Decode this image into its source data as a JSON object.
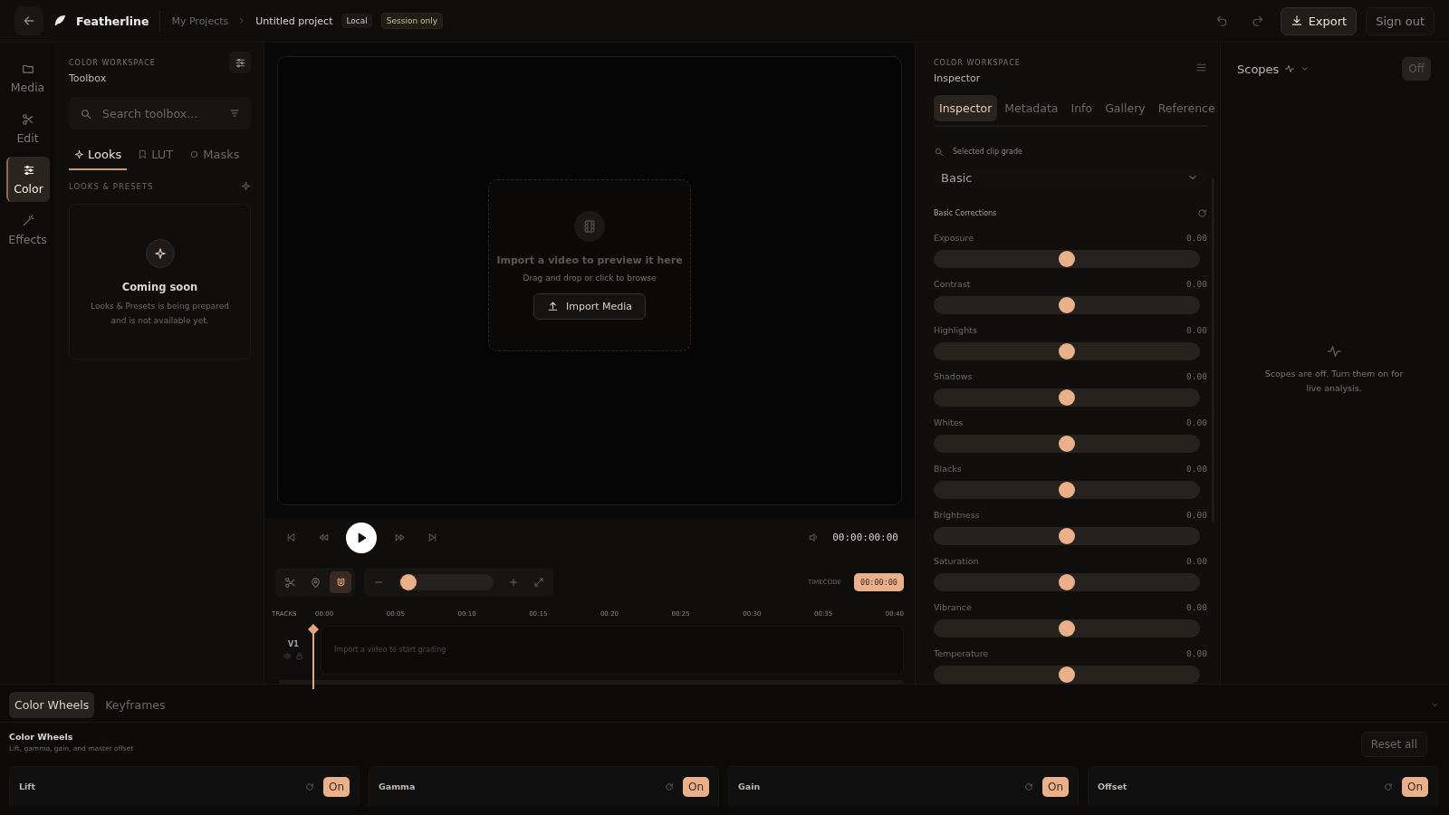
{
  "app": {
    "name": "Featherline"
  },
  "breadcrumb": {
    "parent": "My Projects",
    "project": "Untitled project",
    "badges": [
      {
        "label": "Local",
        "kind": "neutral"
      },
      {
        "label": "Session only",
        "kind": "session"
      }
    ]
  },
  "top_actions": {
    "export": "Export",
    "sign_out": "Sign out"
  },
  "nav": [
    {
      "label": "Media",
      "kind": "folder",
      "selected": false
    },
    {
      "label": "Edit",
      "kind": "scissors",
      "selected": false
    },
    {
      "label": "Color",
      "kind": "sliders",
      "selected": true
    },
    {
      "label": "Effects",
      "kind": "wand",
      "selected": false
    }
  ],
  "toolbox": {
    "eyebrow": "COLOR WORKSPACE",
    "title": "Toolbox",
    "search_placeholder": "Search toolbox...",
    "tabs": [
      {
        "label": "Looks",
        "kind": "sparkle",
        "selected": true
      },
      {
        "label": "LUT",
        "kind": "bookmark",
        "selected": false
      },
      {
        "label": "Masks",
        "kind": "circle",
        "selected": false
      }
    ],
    "section": "LOOKS & PRESETS",
    "empty_title": "Coming soon",
    "empty_text": "Looks & Presets is being prepared and is not available yet."
  },
  "preview": {
    "title": "Import a video to preview it here",
    "subtitle": "Drag and drop or click to browse",
    "button": "Import Media"
  },
  "transport": {
    "timecode": "00:00:00:00"
  },
  "timeline": {
    "tools": [
      {
        "kind": "cut",
        "selected": false
      },
      {
        "kind": "marker",
        "selected": false
      },
      {
        "kind": "snap",
        "selected": true
      }
    ],
    "zoom": {
      "level": 0.1
    },
    "timecode_label": "TIMECODE",
    "timecode": "00:00:00",
    "tracks_label": "TRACKS",
    "ticks": [
      "00:00",
      "00:05",
      "00:10",
      "00:15",
      "00:20",
      "00:25",
      "00:30",
      "00:35",
      "00:40"
    ],
    "track": {
      "name": "V1",
      "empty_text": "Import a video to start grading"
    }
  },
  "inspector": {
    "eyebrow": "COLOR WORKSPACE",
    "title": "Inspector",
    "tabs": [
      {
        "label": "Inspector",
        "selected": true
      },
      {
        "label": "Metadata",
        "selected": false
      },
      {
        "label": "Info",
        "selected": false
      },
      {
        "label": "Gallery",
        "selected": false
      },
      {
        "label": "Reference",
        "selected": false
      }
    ],
    "search_placeholder": "Selected clip grade",
    "preset": "Basic",
    "section": "Basic Corrections",
    "sliders": [
      {
        "name": "Exposure",
        "value": "0.00",
        "level": 0.5
      },
      {
        "name": "Contrast",
        "value": "0.00",
        "level": 0.5
      },
      {
        "name": "Highlights",
        "value": "0.00",
        "level": 0.5
      },
      {
        "name": "Shadows",
        "value": "0.00",
        "level": 0.5
      },
      {
        "name": "Whites",
        "value": "0.00",
        "level": 0.5
      },
      {
        "name": "Blacks",
        "value": "0.00",
        "level": 0.5
      },
      {
        "name": "Brightness",
        "value": "0.00",
        "level": 0.5
      },
      {
        "name": "Saturation",
        "value": "0.00",
        "level": 0.5
      },
      {
        "name": "Vibrance",
        "value": "0.00",
        "level": 0.5
      },
      {
        "name": "Temperature",
        "value": "0.00",
        "level": 0.5
      }
    ]
  },
  "scopes": {
    "title": "Scopes",
    "toggle": "Off",
    "on": false,
    "message": "Scopes are off. Turn them on for live analysis."
  },
  "bottom": {
    "tabs": [
      {
        "label": "Color Wheels",
        "selected": true
      },
      {
        "label": "Keyframes",
        "selected": false
      }
    ],
    "title": "Color Wheels",
    "subtitle": "Lift, gamma, gain, and master offset",
    "reset": "Reset all",
    "wheels": [
      {
        "name": "Lift",
        "toggle": "On",
        "on": true
      },
      {
        "name": "Gamma",
        "toggle": "On",
        "on": true
      },
      {
        "name": "Gain",
        "toggle": "On",
        "on": true
      },
      {
        "name": "Offset",
        "toggle": "On",
        "on": true
      }
    ]
  }
}
